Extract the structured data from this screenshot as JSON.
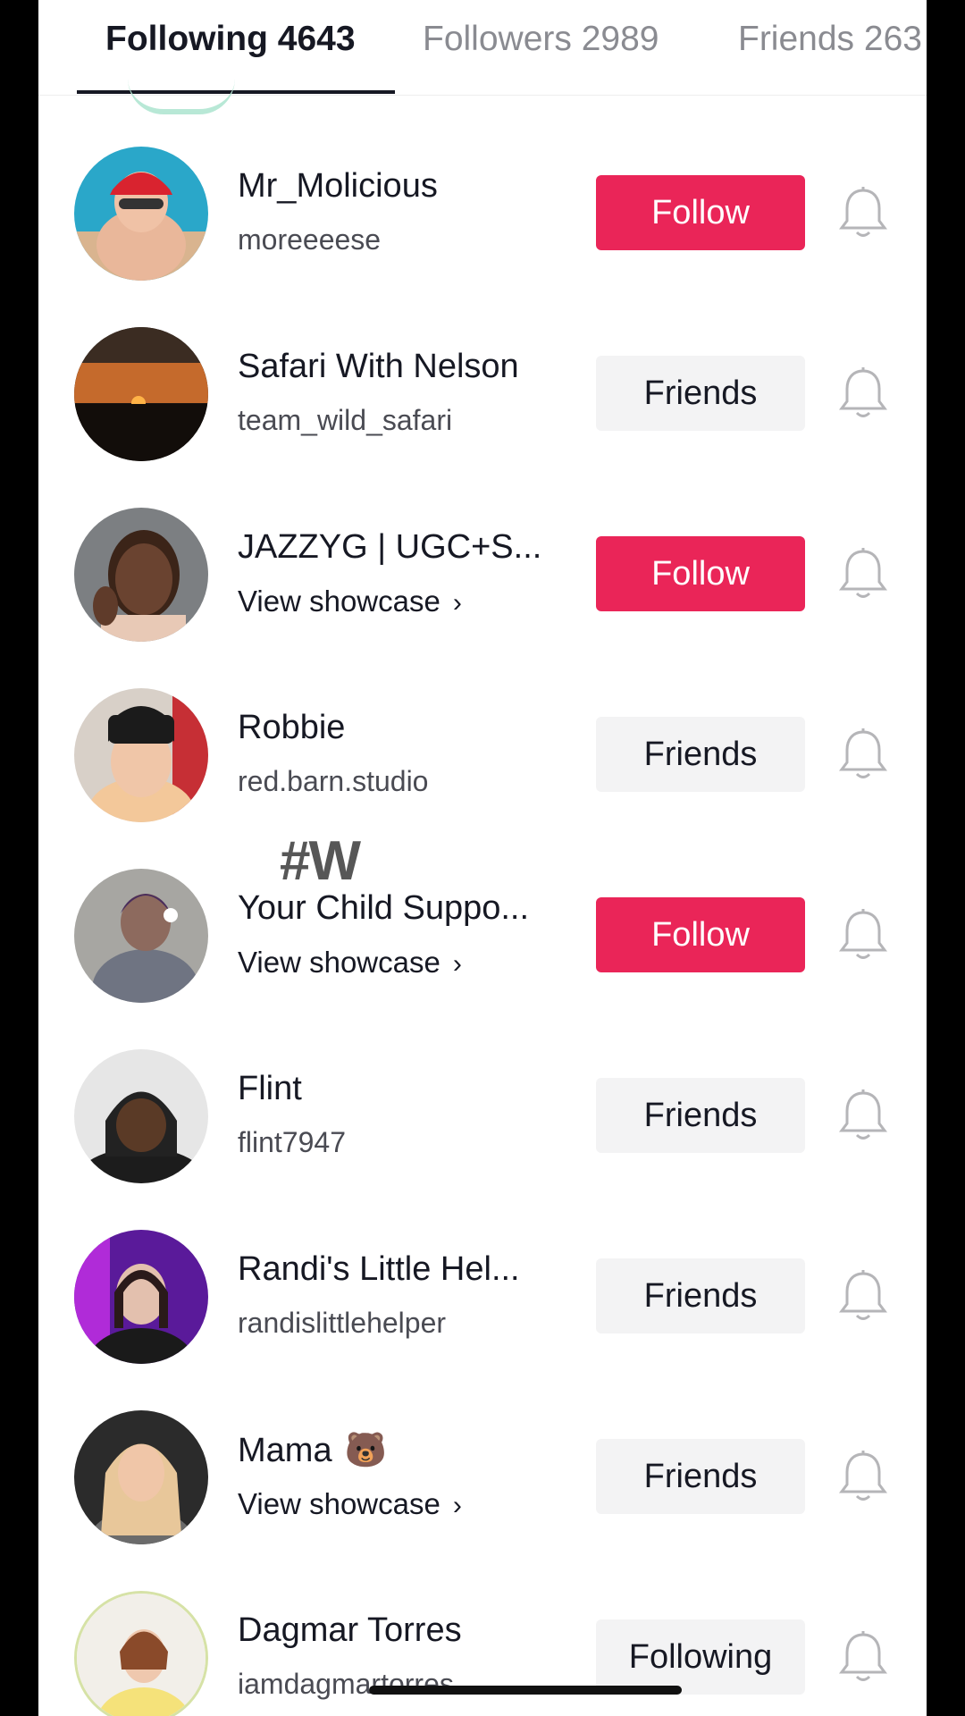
{
  "tabs": [
    {
      "label": "Following 4643",
      "active": true
    },
    {
      "label": "Followers 2989",
      "active": false
    },
    {
      "label": "Friends 263",
      "active": false
    }
  ],
  "overlay_text": {
    "hashtag": "#W"
  },
  "users": [
    {
      "name": "Mr_Molicious",
      "sub": "moreeeese",
      "sub_type": "username",
      "button": "Follow",
      "button_style": "follow"
    },
    {
      "name": "Safari With Nelson",
      "sub": "team_wild_safari",
      "sub_type": "username",
      "button": "Friends",
      "button_style": "friends"
    },
    {
      "name": "JAZZYG | UGC+S...",
      "sub": "View showcase",
      "sub_type": "showcase",
      "button": "Follow",
      "button_style": "follow"
    },
    {
      "name": "Robbie",
      "sub": "red.barn.studio",
      "sub_type": "username",
      "button": "Friends",
      "button_style": "friends"
    },
    {
      "name": "Your Child Suppo...",
      "sub": "View showcase",
      "sub_type": "showcase",
      "button": "Follow",
      "button_style": "follow"
    },
    {
      "name": "Flint",
      "sub": "flint7947",
      "sub_type": "username",
      "button": "Friends",
      "button_style": "friends"
    },
    {
      "name": "Randi's Little Hel...",
      "sub": "randislittlehelper",
      "sub_type": "username",
      "button": "Friends",
      "button_style": "friends"
    },
    {
      "name": "Mama",
      "name_emoji": "🐻",
      "sub": "View showcase",
      "sub_type": "showcase",
      "button": "Friends",
      "button_style": "friends"
    },
    {
      "name": "Dagmar Torres",
      "sub": "iamdagmartorres",
      "sub_type": "username",
      "button": "Following",
      "button_style": "friends"
    }
  ],
  "colors": {
    "follow": "#ea2558",
    "friends_bg": "#f3f3f4",
    "text": "#161823"
  },
  "icons": {
    "bell": "bell-icon",
    "chevron": "chevron-right-icon"
  }
}
